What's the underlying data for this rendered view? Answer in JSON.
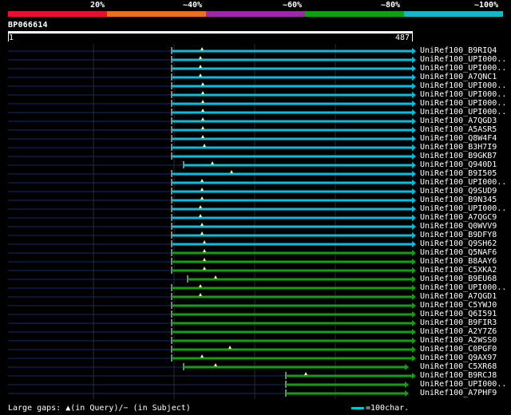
{
  "ruler": {
    "labels": [
      "20%",
      "~40%",
      "~60%",
      "~80%",
      "~100%"
    ],
    "colors": [
      "#e8102c",
      "#e87020",
      "#9a2aa6",
      "#12a012",
      "#12b8c8"
    ]
  },
  "query": {
    "title": "BP066614",
    "start": "1",
    "end": "487"
  },
  "hits": [
    {
      "label": "UniRef100_B9RIQ4",
      "color": "#00c0e0",
      "start": 215,
      "end": 516,
      "marker": 253
    },
    {
      "label": "UniRef100_UPI000..",
      "color": "#00c0e0",
      "start": 215,
      "end": 516,
      "marker": 251
    },
    {
      "label": "UniRef100_UPI000..",
      "color": "#00c0e0",
      "start": 215,
      "end": 516,
      "marker": 251
    },
    {
      "label": "UniRef100_A7QNC1",
      "color": "#00c0e0",
      "start": 215,
      "end": 516,
      "marker": 251
    },
    {
      "label": "UniRef100_UPI000..",
      "color": "#00c0e0",
      "start": 215,
      "end": 516,
      "marker": 254
    },
    {
      "label": "UniRef100_UPI000..",
      "color": "#00c0e0",
      "start": 215,
      "end": 516,
      "marker": 254
    },
    {
      "label": "UniRef100_UPI000..",
      "color": "#00c0e0",
      "start": 215,
      "end": 516,
      "marker": 254
    },
    {
      "label": "UniRef100_UPI000..",
      "color": "#00c0e0",
      "start": 215,
      "end": 516,
      "marker": 254
    },
    {
      "label": "UniRef100_A7QGD3",
      "color": "#00c0e0",
      "start": 215,
      "end": 516,
      "marker": 254
    },
    {
      "label": "UniRef100_A5ASR5",
      "color": "#00c0e0",
      "start": 215,
      "end": 516,
      "marker": 254
    },
    {
      "label": "UniRef100_Q8W4F4",
      "color": "#00c0e0",
      "start": 215,
      "end": 516,
      "marker": 254
    },
    {
      "label": "UniRef100_B3H7I9",
      "color": "#00c0e0",
      "start": 215,
      "end": 516,
      "marker": 256
    },
    {
      "label": "UniRef100_B9GKB7",
      "color": "#00c0e0",
      "start": 215,
      "end": 516,
      "marker": null
    },
    {
      "label": "UniRef100_Q940D1",
      "color": "#00c0e0",
      "start": 230,
      "end": 516,
      "marker": 266
    },
    {
      "label": "UniRef100_B9I505",
      "color": "#00c0e0",
      "start": 215,
      "end": 516,
      "marker": 290
    },
    {
      "label": "UniRef100_UPI000..",
      "color": "#00c0e0",
      "start": 215,
      "end": 516,
      "marker": 253
    },
    {
      "label": "UniRef100_Q9SUD9",
      "color": "#00c0e0",
      "start": 215,
      "end": 516,
      "marker": 253
    },
    {
      "label": "UniRef100_B9N345",
      "color": "#00c0e0",
      "start": 215,
      "end": 516,
      "marker": 253
    },
    {
      "label": "UniRef100_UPI000..",
      "color": "#00c0e0",
      "start": 215,
      "end": 516,
      "marker": 251
    },
    {
      "label": "UniRef100_A7QGC9",
      "color": "#00c0e0",
      "start": 215,
      "end": 516,
      "marker": 251
    },
    {
      "label": "UniRef100_Q0WVV9",
      "color": "#00c0e0",
      "start": 215,
      "end": 516,
      "marker": 253
    },
    {
      "label": "UniRef100_B9DFY8",
      "color": "#00c0e0",
      "start": 215,
      "end": 516,
      "marker": 253
    },
    {
      "label": "UniRef100_Q9SH62",
      "color": "#00c0e0",
      "start": 215,
      "end": 516,
      "marker": 256
    },
    {
      "label": "UniRef100_Q5NAF6",
      "color": "#12a012",
      "start": 215,
      "end": 516,
      "marker": 256
    },
    {
      "label": "UniRef100_B8AAY6",
      "color": "#12a012",
      "start": 215,
      "end": 516,
      "marker": 256
    },
    {
      "label": "UniRef100_C5XKA2",
      "color": "#12a012",
      "start": 215,
      "end": 516,
      "marker": 256
    },
    {
      "label": "UniRef100_B9EU68",
      "color": "#12a012",
      "start": 235,
      "end": 516,
      "marker": 270
    },
    {
      "label": "UniRef100_UPI000..",
      "color": "#12a012",
      "start": 215,
      "end": 516,
      "marker": 251
    },
    {
      "label": "UniRef100_A7QGD1",
      "color": "#12a012",
      "start": 215,
      "end": 516,
      "marker": 251
    },
    {
      "label": "UniRef100_C5YWJ0",
      "color": "#12a012",
      "start": 215,
      "end": 516,
      "marker": null
    },
    {
      "label": "UniRef100_Q6I591",
      "color": "#12a012",
      "start": 215,
      "end": 516,
      "marker": null
    },
    {
      "label": "UniRef100_B9FIR3",
      "color": "#12a012",
      "start": 215,
      "end": 516,
      "marker": null
    },
    {
      "label": "UniRef100_A2Y7Z6",
      "color": "#12a012",
      "start": 215,
      "end": 516,
      "marker": null
    },
    {
      "label": "UniRef100_A2WSS0",
      "color": "#12a012",
      "start": 215,
      "end": 516,
      "marker": null
    },
    {
      "label": "UniRef100_C0PGF0",
      "color": "#12a012",
      "start": 215,
      "end": 516,
      "marker": 288
    },
    {
      "label": "UniRef100_Q9AX97",
      "color": "#12a012",
      "start": 215,
      "end": 516,
      "marker": 253
    },
    {
      "label": "UniRef100_C5XR68",
      "color": "#12a012",
      "start": 230,
      "end": 507,
      "marker": 270
    },
    {
      "label": "UniRef100_B9RCJ8",
      "color": "#12a012",
      "start": 358,
      "end": 516,
      "marker": 383
    },
    {
      "label": "UniRef100_UPI000..",
      "color": "#12a012",
      "start": 358,
      "end": 507,
      "marker": null
    },
    {
      "label": "UniRef100_A7PHF9",
      "color": "#12a012",
      "start": 358,
      "end": 507,
      "marker": null
    }
  ],
  "legend": {
    "gaps_text": "Large gaps: ▲(in Query)/− (in Subject)",
    "scale_text": "=100char."
  }
}
